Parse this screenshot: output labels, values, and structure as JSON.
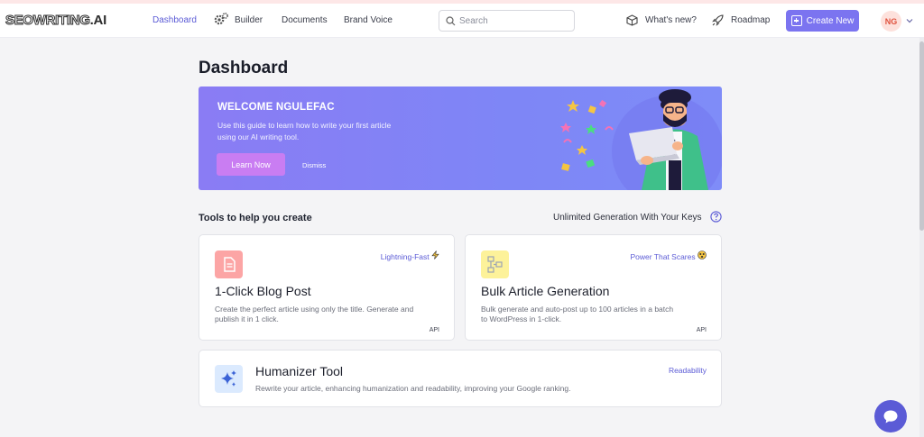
{
  "header": {
    "logo": {
      "main": "SEOWRITING",
      "accent": ".AI"
    },
    "nav": [
      {
        "label": "Dashboard",
        "active": true
      },
      {
        "label": "Builder",
        "icon": "gears-icon"
      },
      {
        "label": "Documents"
      },
      {
        "label": "Brand Voice"
      }
    ],
    "search": {
      "placeholder": "Search",
      "value": "",
      "icon": "search-icon"
    },
    "whats_new": {
      "label": "What's new?",
      "icon": "box-icon"
    },
    "roadmap": {
      "label": "Roadmap",
      "icon": "rocket-icon"
    },
    "create_new": {
      "label": "Create New",
      "icon": "add-square-icon"
    },
    "user": {
      "initials": "NG",
      "menu_icon": "chevron-down-icon"
    }
  },
  "page": {
    "title": "Dashboard"
  },
  "banner": {
    "title": "WELCOME NGULEFAC",
    "text": "Use this guide to learn how to write your first article using our AI writing tool.",
    "learn_label": "Learn Now",
    "dismiss_label": "Dismiss",
    "illustration": "man-with-laptop-illustration"
  },
  "tools": {
    "section_title": "Tools to help you create",
    "unlimited_label": "Unlimited Generation With Your Keys",
    "help_icon": "question-circle-icon",
    "cards": [
      {
        "title": "1-Click Blog Post",
        "tag": "Lightning-Fast",
        "tag_icon": "lightning-icon",
        "desc": "Create the perfect article using only the title. Generate and publish it in 1 click.",
        "badge": "API",
        "icon": "document-icon",
        "icon_bg": "#fca5a5"
      },
      {
        "title": "Bulk Article Generation",
        "tag": "Power That Scares",
        "tag_icon": "scared-face-icon",
        "desc": "Bulk generate and auto-post up to 100 articles in a batch to WordPress in 1-click.",
        "badge": "API",
        "icon": "flowchart-icon",
        "icon_bg": "#fdf29a"
      },
      {
        "title": "Humanizer Tool",
        "tag": "Readability",
        "desc": "Rewrite your article, enhancing humanization and readability, improving your Google ranking.",
        "icon": "sparkles-icon",
        "icon_bg": "#dbeafe"
      }
    ]
  },
  "chat": {
    "icon": "chat-bubble-icon"
  },
  "colors": {
    "accent": "#5b5bd6",
    "create_button": "#7b74f0",
    "learn_button": "#c97df2",
    "banner_start": "#8a7cf4",
    "banner_end": "#7f8cf8"
  }
}
